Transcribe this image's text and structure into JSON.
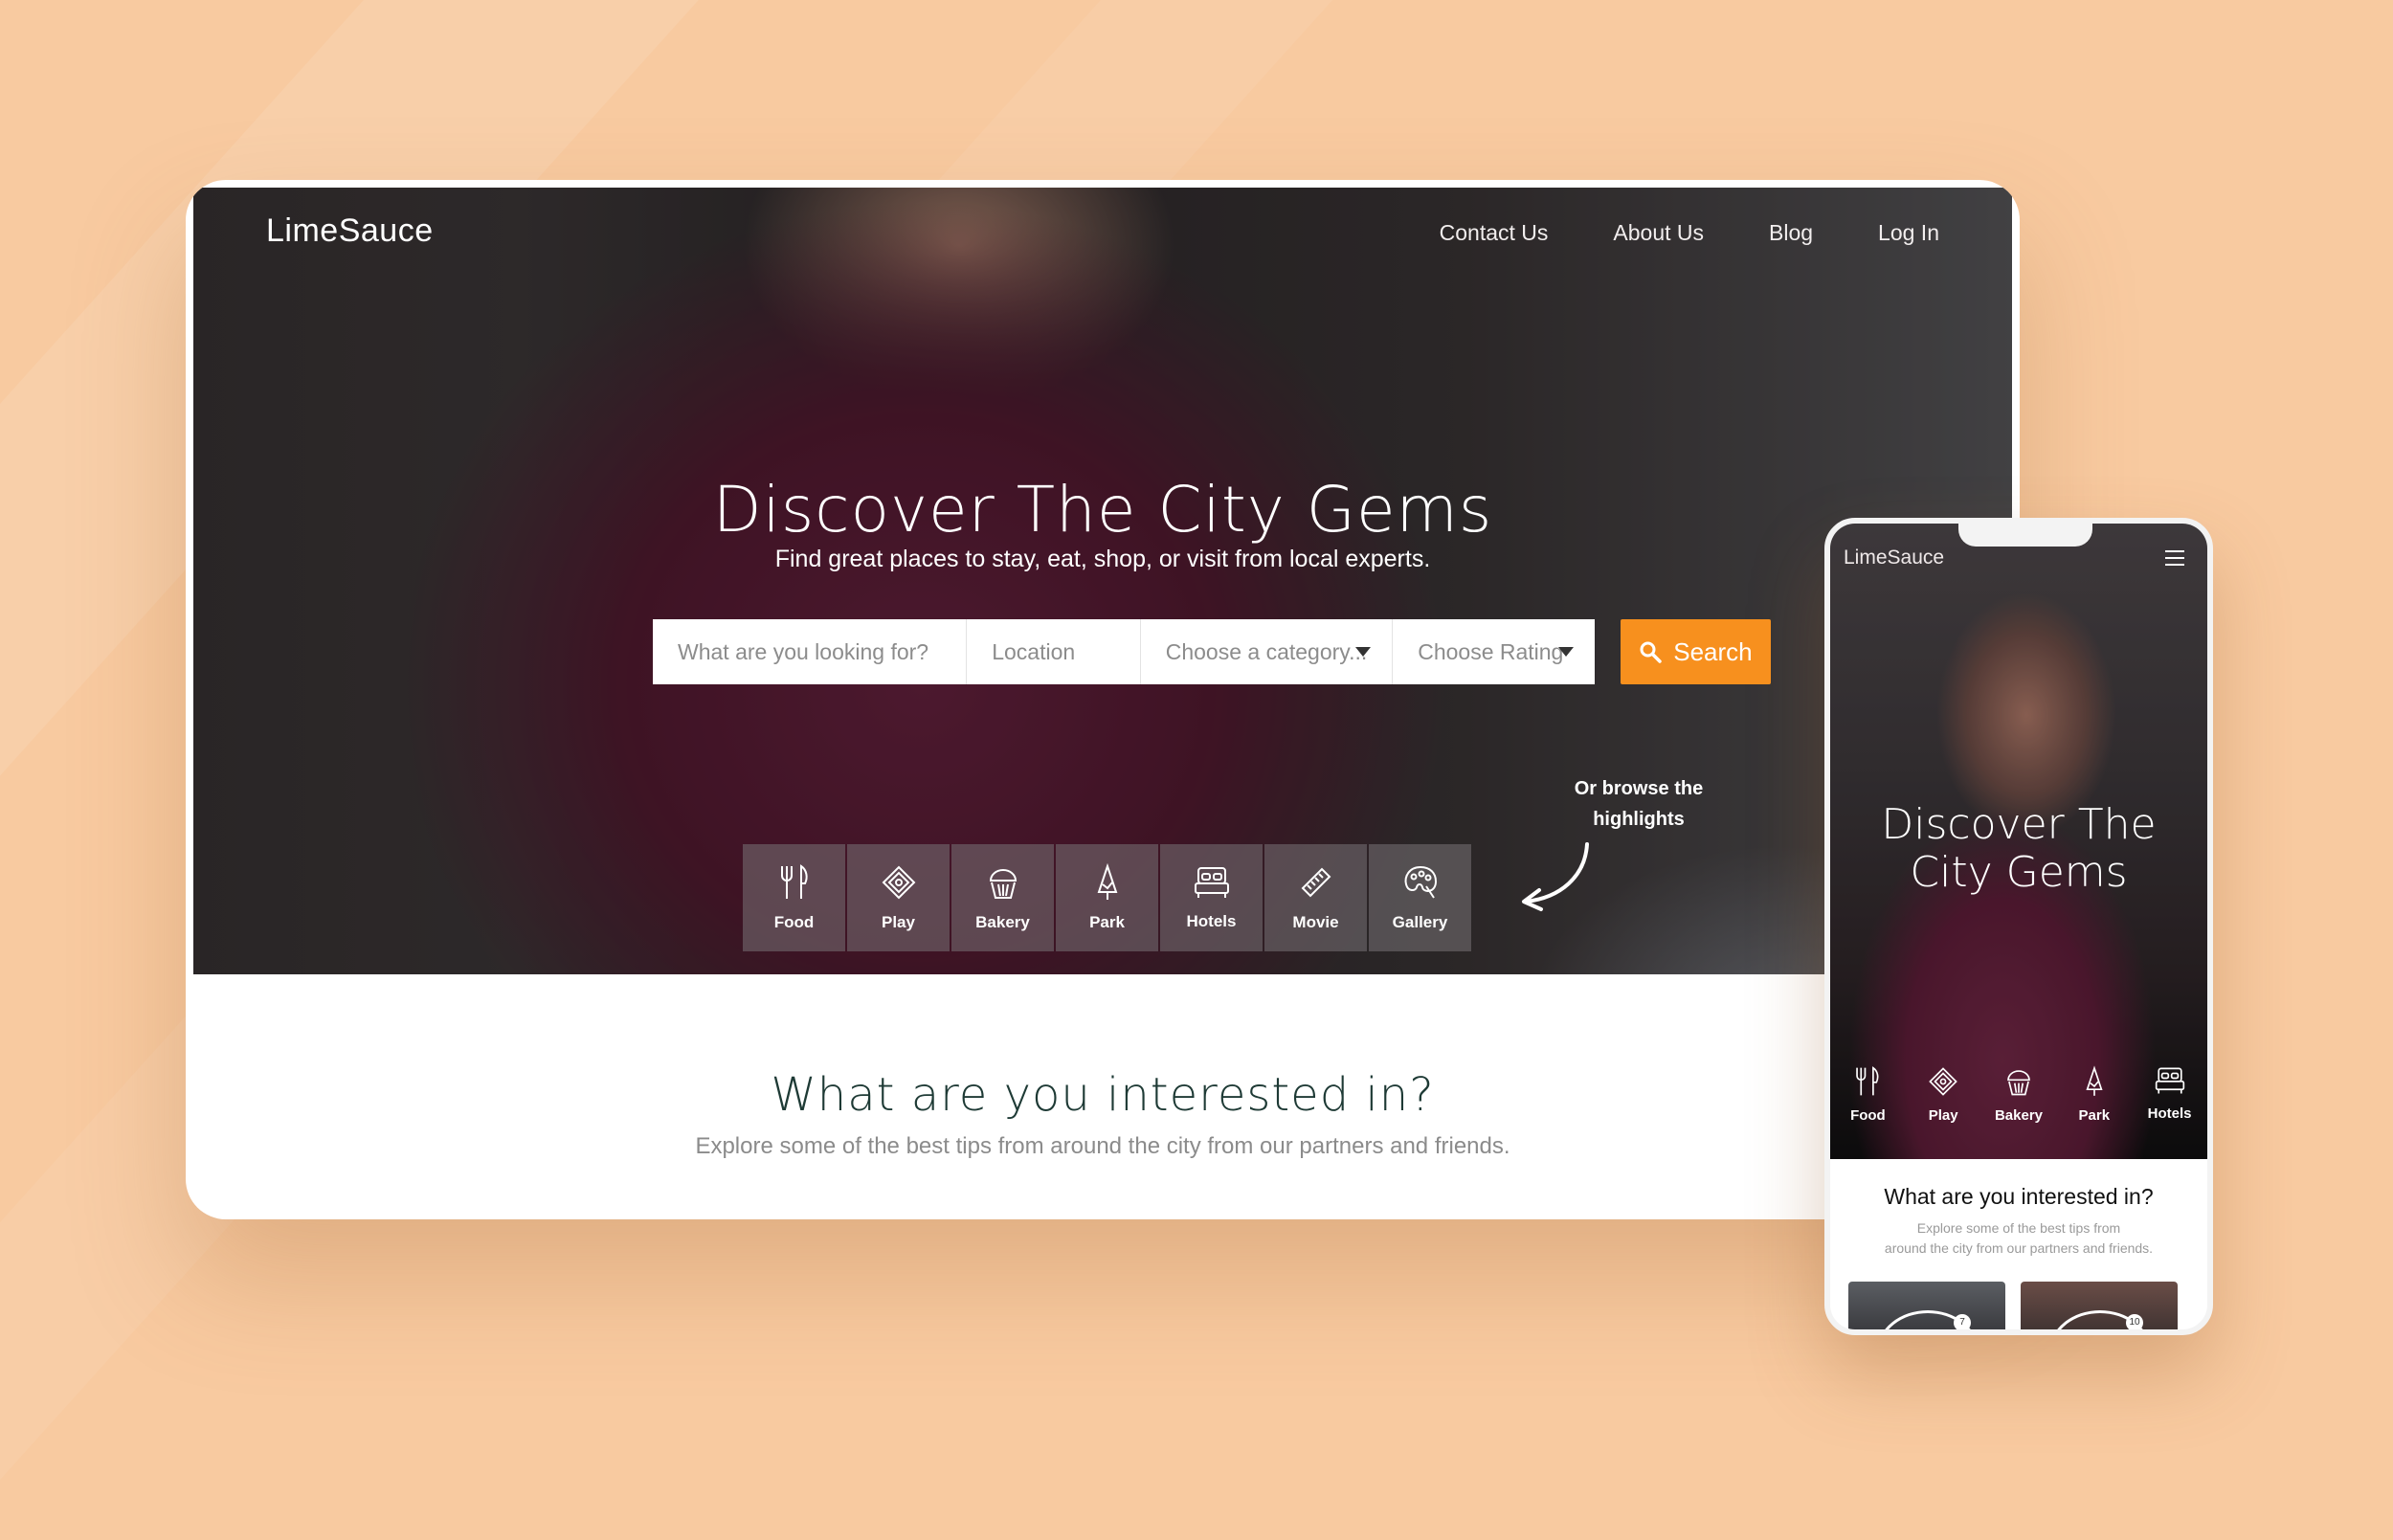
{
  "brand": "LimeSauce",
  "desktop": {
    "nav": [
      "Contact Us",
      "About Us",
      "Blog",
      "Log In"
    ],
    "hero": {
      "title": "Discover The City Gems",
      "subtitle": "Find great places to stay, eat, shop, or visit from local experts."
    },
    "search": {
      "what_placeholder": "What are you looking for?",
      "location_placeholder": "Location",
      "category_placeholder": "Choose a category...",
      "rating_placeholder": "Choose Rating",
      "button_label": "Search"
    },
    "browse_hint_line1": "Or browse the",
    "browse_hint_line2": "highlights",
    "categories": [
      {
        "label": "Food",
        "icon": "fork-knife-icon"
      },
      {
        "label": "Play",
        "icon": "ticket-icon"
      },
      {
        "label": "Bakery",
        "icon": "cupcake-icon"
      },
      {
        "label": "Park",
        "icon": "tree-icon"
      },
      {
        "label": "Hotels",
        "icon": "bed-icon"
      },
      {
        "label": "Movie",
        "icon": "film-icon"
      },
      {
        "label": "Gallery",
        "icon": "palette-icon"
      }
    ],
    "interest": {
      "title": "What are you interested in?",
      "subtitle": "Explore some of the best tips from around the city from our partners and friends."
    }
  },
  "mobile": {
    "brand": "LimeSauce",
    "hero_title_line1": "Discover The",
    "hero_title_line2": "City Gems",
    "categories": [
      {
        "label": "Food",
        "icon": "fork-knife-icon"
      },
      {
        "label": "Play",
        "icon": "ticket-icon"
      },
      {
        "label": "Bakery",
        "icon": "cupcake-icon"
      },
      {
        "label": "Park",
        "icon": "tree-icon"
      },
      {
        "label": "Hotels",
        "icon": "bed-icon"
      }
    ],
    "interest_title": "What are you interested in?",
    "interest_sub_line1": "Explore some of the best tips from",
    "interest_sub_line2": "around the city from our partners and friends.",
    "card_badges": [
      "7",
      "10"
    ]
  },
  "colors": {
    "background": "#f8caa0",
    "accent": "#f7901e",
    "heading_dark": "#1e3a35"
  }
}
